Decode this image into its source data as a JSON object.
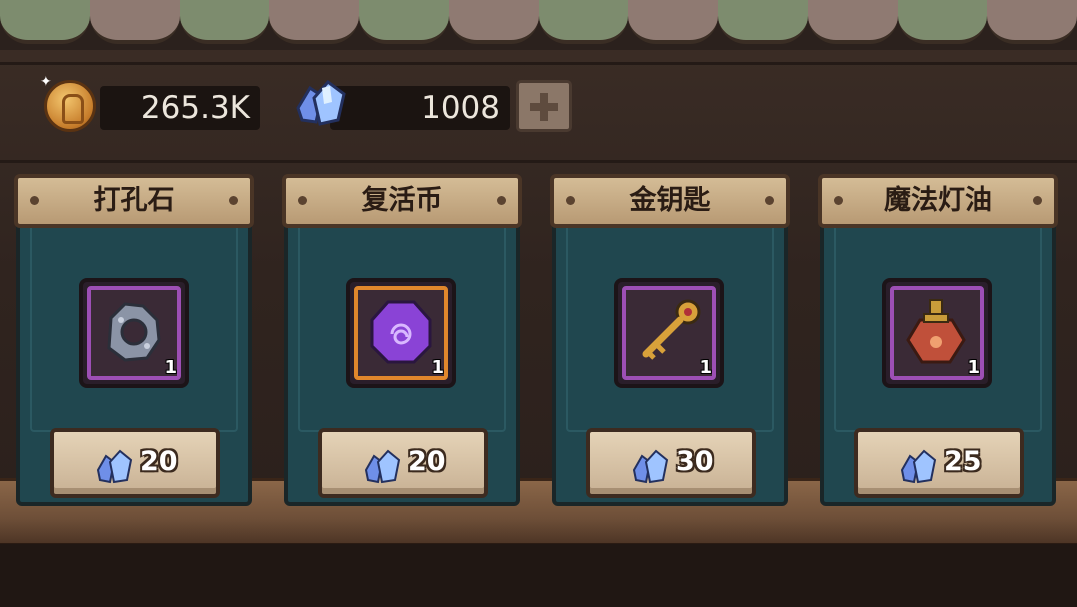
{
  "currency": {
    "gold": {
      "icon": "gold-coin-icon",
      "value": "265.3K"
    },
    "gems": {
      "icon": "blue-gem-icon",
      "value": "1008"
    },
    "add_button_icon": "plus-icon"
  },
  "shop_items": [
    {
      "name": "打孔石",
      "icon": "punch-stone-icon",
      "quantity": "1",
      "price": "20",
      "price_icon": "blue-gem-icon",
      "frame_color": "#9d4fb5"
    },
    {
      "name": "复活币",
      "icon": "revive-coin-icon",
      "quantity": "1",
      "price": "20",
      "price_icon": "blue-gem-icon",
      "frame_color": "#e0872c"
    },
    {
      "name": "金钥匙",
      "icon": "gold-key-icon",
      "quantity": "1",
      "price": "30",
      "price_icon": "blue-gem-icon",
      "frame_color": "#9d4fb5"
    },
    {
      "name": "魔法灯油",
      "icon": "magic-lamp-oil-icon",
      "quantity": "1",
      "price": "25",
      "price_icon": "blue-gem-icon",
      "frame_color": "#9d4fb5"
    }
  ]
}
